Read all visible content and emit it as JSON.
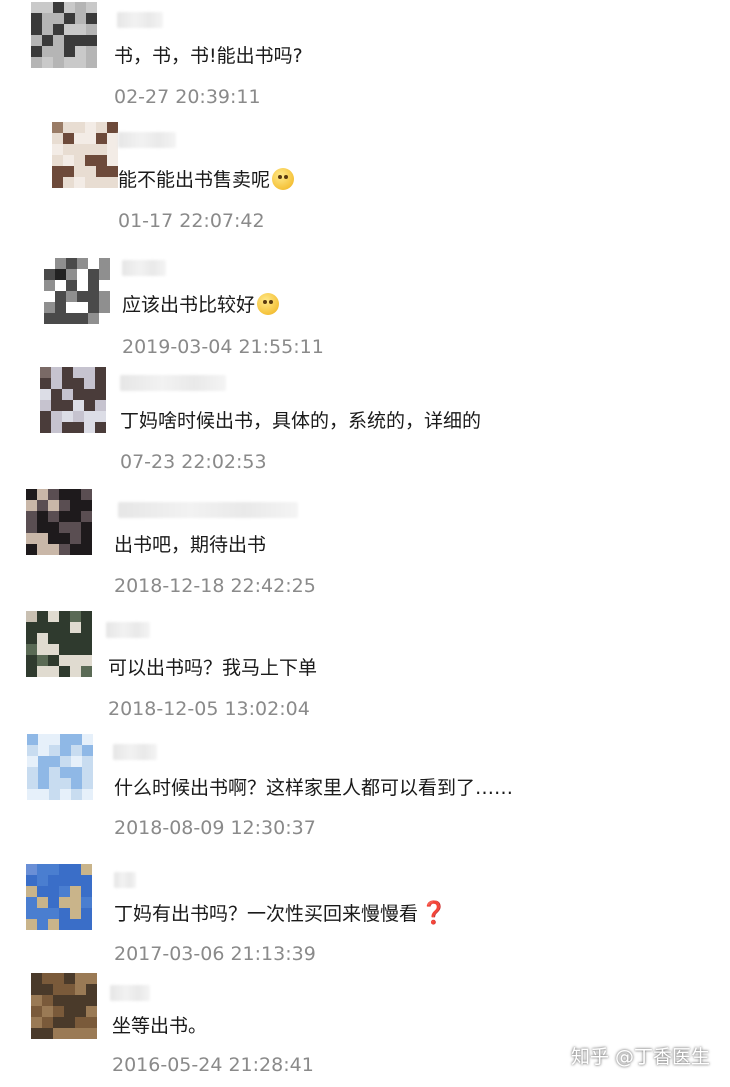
{
  "comments": [
    {
      "text": "书，书，书!能出书吗?",
      "time": "02-27 20:39:11"
    },
    {
      "text": "能不能出书售卖呢",
      "time": "01-17 22:07:42",
      "emoji": "dizzy-face-emoji"
    },
    {
      "text": "应该出书比较好",
      "time": "2019-03-04 21:55:11",
      "emoji": "smile-emoji"
    },
    {
      "text": "丁妈啥时候出书，具体的，系统的，详细的",
      "time": "07-23 22:02:53"
    },
    {
      "text": "出书吧，期待出书",
      "time": "2018-12-18 22:42:25"
    },
    {
      "text": "可以出书吗？我马上下单",
      "time": "2018-12-05 13:02:04"
    },
    {
      "text": "什么时候出书啊？这样家里人都可以看到了……",
      "time": "2018-08-09 12:30:37"
    },
    {
      "text": "丁妈有出书吗？一次性买回来慢慢看",
      "time": "2017-03-06 21:13:39",
      "suffix": "❓"
    },
    {
      "text": "坐等出书。",
      "time": "2016-05-24 21:28:41"
    }
  ],
  "watermark": "知乎 @丁香医生",
  "colors": {
    "text": "#1a1a1a",
    "time": "#8a8a8a",
    "question_mark": "#d6262b"
  }
}
